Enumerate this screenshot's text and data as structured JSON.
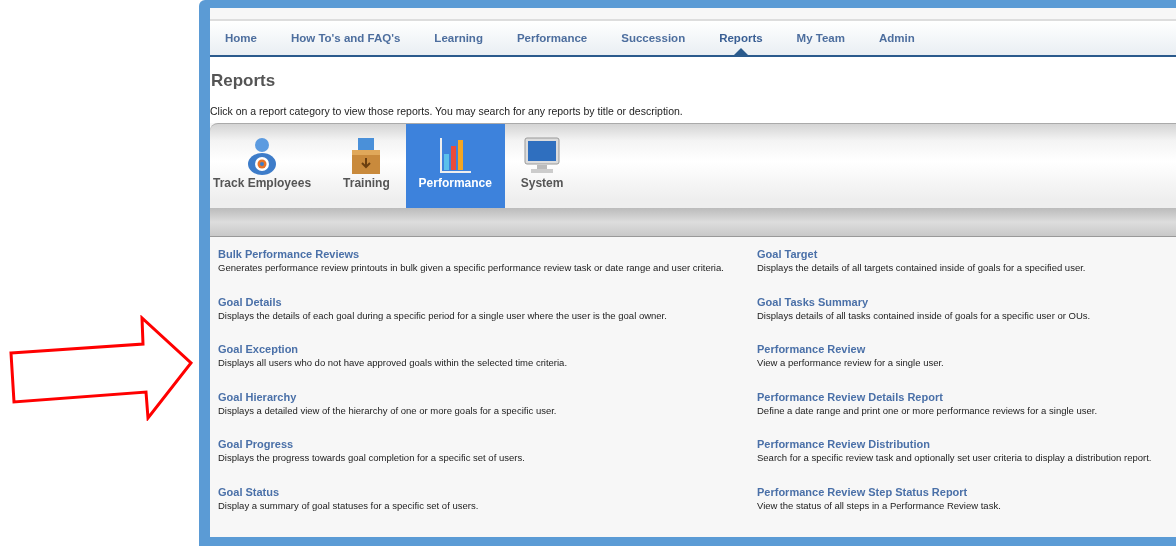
{
  "nav": [
    {
      "label": "Home",
      "selected": false
    },
    {
      "label": "How To's and FAQ's",
      "selected": false
    },
    {
      "label": "Learning",
      "selected": false
    },
    {
      "label": "Performance",
      "selected": false
    },
    {
      "label": "Succession",
      "selected": false
    },
    {
      "label": "Reports",
      "selected": true
    },
    {
      "label": "My Team",
      "selected": false
    },
    {
      "label": "Admin",
      "selected": false
    }
  ],
  "page_title": "Reports",
  "intro": "Click on a report category to view those reports. You may search for any reports by title or description.",
  "categories": [
    {
      "label": "Track Employees",
      "kind": "person",
      "selected": false
    },
    {
      "label": "Training",
      "kind": "box",
      "selected": false
    },
    {
      "label": "Performance",
      "kind": "chart",
      "selected": true
    },
    {
      "label": "System",
      "kind": "monitor",
      "selected": false
    }
  ],
  "reports_left": [
    {
      "title": "Bulk Performance Reviews",
      "description": "Generates performance review printouts in bulk given a specific performance review task or date range and user criteria."
    },
    {
      "title": "Goal Details",
      "description": "Displays the details of each goal during a specific period for a single user where the user is the goal owner."
    },
    {
      "title": "Goal Exception",
      "description": "Displays all users who do not have approved goals within the selected time criteria."
    },
    {
      "title": "Goal Hierarchy",
      "description": "Displays a detailed view of the hierarchy of one or more goals for a specific user."
    },
    {
      "title": "Goal Progress",
      "description": "Displays the progress towards goal completion for a specific set of users."
    },
    {
      "title": "Goal Status",
      "description": "Display a summary of goal statuses for a specific set of users."
    }
  ],
  "reports_right": [
    {
      "title": "Goal Target",
      "description": "Displays the details of all targets contained inside of goals for a specified user."
    },
    {
      "title": "Goal Tasks Summary",
      "description": "Displays details of all tasks contained inside of goals for a specific user or OUs."
    },
    {
      "title": "Performance Review",
      "description": "View a performance review for a single user."
    },
    {
      "title": "Performance Review Details Report",
      "description": "Define a date range and print one or more performance reviews for a single user."
    },
    {
      "title": "Performance Review Distribution",
      "description": "Search for a specific review task and optionally set user criteria to display a distribution report."
    },
    {
      "title": "Performance Review Step Status Report",
      "description": "View the status of all steps in a Performance Review task."
    }
  ]
}
